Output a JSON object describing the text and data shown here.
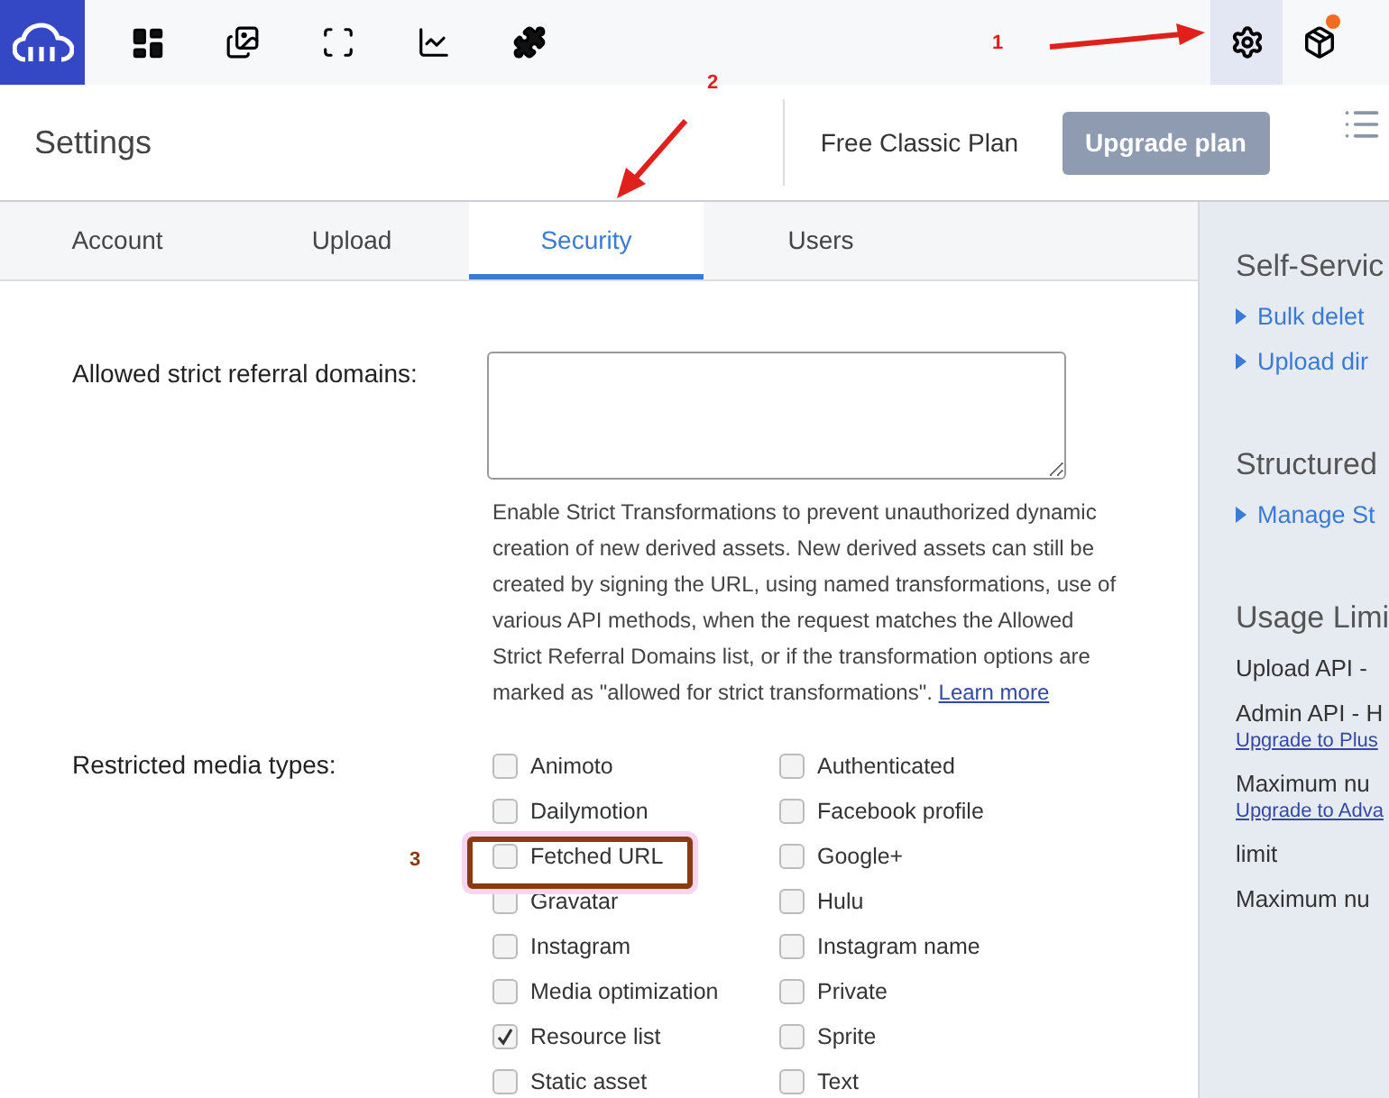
{
  "topbar": {
    "nav": [
      {
        "kind": "dashboard",
        "selected": false
      },
      {
        "kind": "media",
        "selected": false
      },
      {
        "kind": "transform",
        "selected": false
      },
      {
        "kind": "reports",
        "selected": false
      },
      {
        "kind": "addons",
        "selected": false
      }
    ],
    "tools": [
      {
        "kind": "settings",
        "selected": true
      },
      {
        "kind": "package",
        "selected": false,
        "notification": true
      }
    ]
  },
  "header": {
    "title": "Settings",
    "plan": "Free Classic Plan",
    "upgrade_button": "Upgrade plan"
  },
  "tabs": [
    {
      "label": "Account",
      "selected": false
    },
    {
      "label": "Upload",
      "selected": false
    },
    {
      "label": "Security",
      "selected": true
    },
    {
      "label": "Users",
      "selected": false
    }
  ],
  "referral": {
    "label": "Allowed strict referral domains:",
    "help": "Enable Strict Transformations to prevent unauthorized dynamic creation of new derived assets. New derived assets can still be created by signing the URL, using named transformations, use of various API methods, when the request matches the Allowed Strict Referral Domains list, or if the transformation options are marked as \"allowed for strict transformations\".",
    "link": "Learn more"
  },
  "media_types": {
    "label": "Restricted media types:",
    "columns": [
      [
        {
          "label": "Animoto",
          "checked": false
        },
        {
          "label": "Dailymotion",
          "checked": false
        },
        {
          "label": "Fetched URL",
          "checked": false
        },
        {
          "label": "Gravatar",
          "checked": false
        },
        {
          "label": "Instagram",
          "checked": false
        },
        {
          "label": "Media optimization",
          "checked": false
        },
        {
          "label": "Resource list",
          "checked": true
        },
        {
          "label": "Static asset",
          "checked": false
        }
      ],
      [
        {
          "label": "Authenticated",
          "checked": false
        },
        {
          "label": "Facebook profile",
          "checked": false
        },
        {
          "label": "Google+",
          "checked": false
        },
        {
          "label": "Hulu",
          "checked": false
        },
        {
          "label": "Instagram name",
          "checked": false
        },
        {
          "label": "Private",
          "checked": false
        },
        {
          "label": "Sprite",
          "checked": false
        },
        {
          "label": "Text",
          "checked": false
        }
      ]
    ]
  },
  "side_panel": [
    {
      "kind": "heading",
      "text": "Self-Servic"
    },
    {
      "kind": "link",
      "text": "Bulk delet"
    },
    {
      "kind": "link",
      "text": "Upload dir"
    },
    {
      "kind": "heading",
      "text": "Structured"
    },
    {
      "kind": "link",
      "text": "Manage St"
    },
    {
      "kind": "heading",
      "text": "Usage Limi"
    },
    {
      "kind": "text",
      "text": "Upload API -"
    },
    {
      "kind": "text",
      "text": "Admin API - H"
    },
    {
      "kind": "upgrade",
      "text": "Upgrade to Plus"
    },
    {
      "kind": "text",
      "text": "Maximum nu"
    },
    {
      "kind": "upgrade",
      "text": "Upgrade to Adva"
    },
    {
      "kind": "text",
      "text": "limit"
    },
    {
      "kind": "text",
      "text": "Maximum nu"
    }
  ],
  "annotations": [
    {
      "label": "1",
      "color": "#e0211b"
    },
    {
      "label": "2",
      "color": "#e0211b"
    },
    {
      "label": "3",
      "color": "#8a3a10"
    }
  ]
}
